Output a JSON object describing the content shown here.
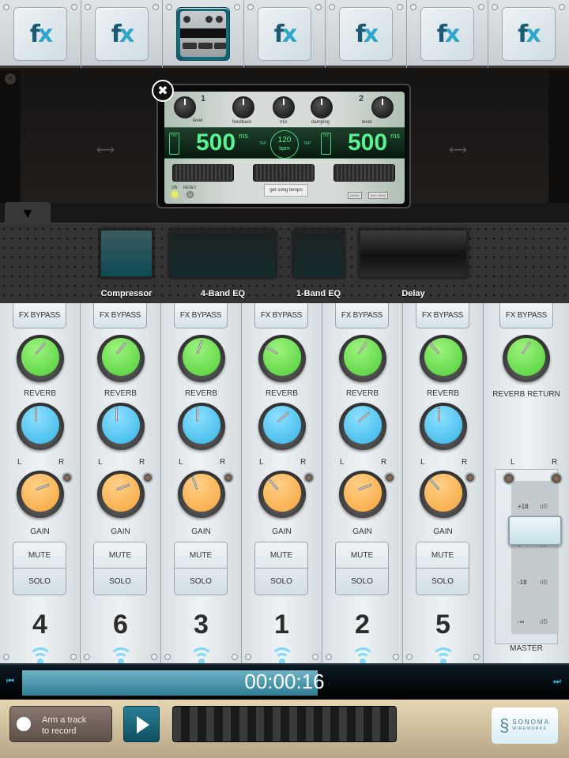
{
  "fx_slots": [
    {
      "label": "fx",
      "icon": "fx-logo-icon",
      "active": false
    },
    {
      "label": "fx",
      "icon": "fx-logo-icon",
      "active": false
    },
    {
      "label": "Delay",
      "icon": "delay-thumbnail-icon",
      "active": true
    },
    {
      "label": "fx",
      "icon": "fx-logo-icon",
      "active": false
    },
    {
      "label": "fx",
      "icon": "fx-logo-icon",
      "active": false
    },
    {
      "label": "fx",
      "icon": "fx-logo-icon",
      "active": false
    },
    {
      "label": "fx",
      "icon": "fx-logo-icon",
      "active": false
    }
  ],
  "delay_unit": {
    "close_icon": "✖",
    "channel_1": "1",
    "channel_2": "2",
    "knobs": [
      "level",
      "feedback",
      "mix",
      "damping",
      "level"
    ],
    "left_time": "500",
    "right_time": "500",
    "time_unit": "ms",
    "ms_toggle": "ms",
    "tempo": "120",
    "tempo_unit": "bpm",
    "tap_label": "TAP",
    "song_tempo_button": "get song tempo",
    "on_label": "ON",
    "reset_label": "RESET",
    "demo_label": "DEMO",
    "buy_label": "BUY NOW"
  },
  "effects_shelf": {
    "toggle_icon": "▼",
    "items": [
      {
        "label": "Compressor"
      },
      {
        "label": "4-Band EQ"
      },
      {
        "label": "1-Band EQ"
      },
      {
        "label": "Delay"
      }
    ]
  },
  "mixer": {
    "bypass_label": "FX BYPASS",
    "reverb_label": "REVERB",
    "gain_label": "GAIN",
    "pan_left": "L",
    "pan_right": "R",
    "mute_label": "MUTE",
    "solo_label": "SOLO",
    "channels": [
      {
        "track": "4",
        "reverb_angle": 220,
        "pan_angle": 180,
        "gain_angle": 250
      },
      {
        "track": "6",
        "reverb_angle": 220,
        "pan_angle": 180,
        "gain_angle": 250
      },
      {
        "track": "3",
        "reverb_angle": 200,
        "pan_angle": 180,
        "gain_angle": 160
      },
      {
        "track": "1",
        "reverb_angle": 120,
        "pan_angle": 230,
        "gain_angle": 140
      },
      {
        "track": "2",
        "reverb_angle": 215,
        "pan_angle": 230,
        "gain_angle": 250
      },
      {
        "track": "5",
        "reverb_angle": 140,
        "pan_angle": 180,
        "gain_angle": 140
      }
    ],
    "master": {
      "bypass_label": "FX BYPASS",
      "reverb_return_label": "REVERB RETURN",
      "reverb_angle": 215,
      "left": "L",
      "right": "R",
      "ticks": [
        {
          "value": "+18",
          "unit": "dB"
        },
        {
          "value": "0",
          "unit": "dB"
        },
        {
          "value": "-18",
          "unit": "dB"
        },
        {
          "value": "-∞",
          "unit": "dB"
        }
      ],
      "fader_level_db": "0",
      "label": "MASTER"
    }
  },
  "transport": {
    "time": "00:00:16",
    "progress": 0.5,
    "skip_start_icon": "⏮",
    "skip_end_icon": "⏭",
    "arm_text_1": "Arm a track",
    "arm_text_2": "to record",
    "logo_top": "SONOMA",
    "logo_bottom": "WIREWORKS"
  }
}
